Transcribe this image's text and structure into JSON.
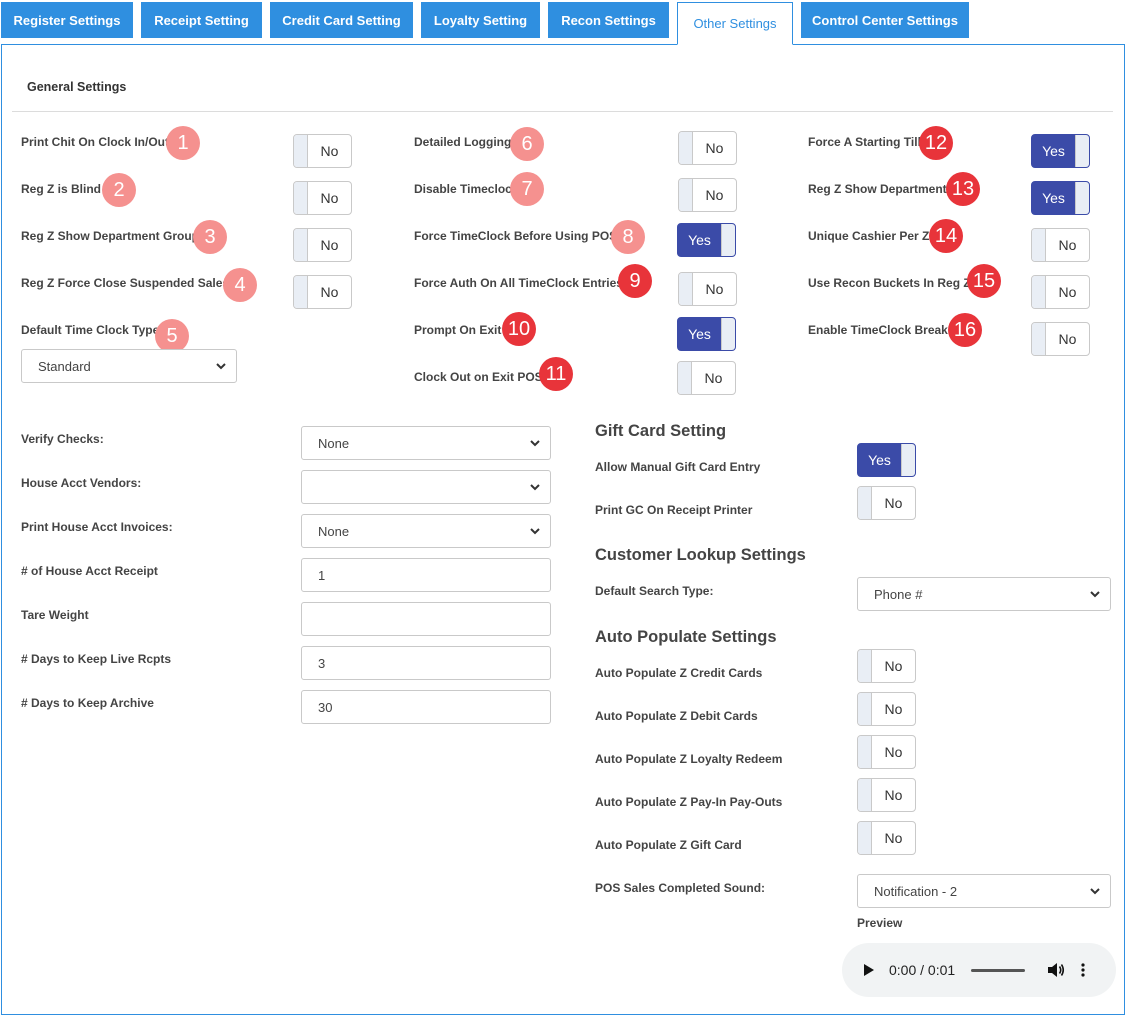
{
  "tabs": [
    "Register Settings",
    "Receipt Setting",
    "Credit Card Setting",
    "Loyalty Setting",
    "Recon Settings",
    "Other Settings",
    "Control Center Settings"
  ],
  "active_tab": "Other Settings",
  "general": {
    "title": "General Settings",
    "col1": [
      {
        "label": "Print Chit On Clock In/Out",
        "value": "No",
        "badge": "1"
      },
      {
        "label": "Reg Z is Blind",
        "value": "No",
        "badge": "2"
      },
      {
        "label": "Reg Z Show Department Group",
        "value": "No",
        "badge": "3"
      },
      {
        "label": "Reg Z Force Close Suspended Sales",
        "value": "No",
        "badge": "4"
      },
      {
        "label": "Default Time Clock Type",
        "badge": "5",
        "select": "Standard"
      }
    ],
    "col2": [
      {
        "label": "Detailed Logging",
        "value": "No",
        "badge": "6"
      },
      {
        "label": "Disable Timeclock",
        "value": "No",
        "badge": "7"
      },
      {
        "label": "Force TimeClock Before Using POS",
        "value": "Yes",
        "badge": "8"
      },
      {
        "label": "Force Auth On All TimeClock Entries",
        "value": "No",
        "badge": "9"
      },
      {
        "label": "Prompt On Exit",
        "value": "Yes",
        "badge": "10"
      },
      {
        "label": "Clock Out on Exit POS",
        "value": "No",
        "badge": "11"
      }
    ],
    "col3": [
      {
        "label": "Force A Starting Till",
        "value": "Yes",
        "badge": "12"
      },
      {
        "label": "Reg Z Show Department",
        "value": "Yes",
        "badge": "13"
      },
      {
        "label": "Unique Cashier Per Z",
        "value": "No",
        "badge": "14"
      },
      {
        "label": "Use Recon Buckets In Reg Z",
        "value": "No",
        "badge": "15"
      },
      {
        "label": "Enable TimeClock Break",
        "value": "No",
        "badge": "16"
      }
    ]
  },
  "left_fields": [
    {
      "label": "Verify Checks:",
      "type": "select",
      "value": "None"
    },
    {
      "label": "House Acct Vendors:",
      "type": "select",
      "value": ""
    },
    {
      "label": "Print House Acct Invoices:",
      "type": "select",
      "value": "None"
    },
    {
      "label": "# of House Acct Receipt",
      "type": "input",
      "value": "1"
    },
    {
      "label": "Tare Weight",
      "type": "input",
      "value": ""
    },
    {
      "label": "# Days to Keep Live Rcpts",
      "type": "input",
      "value": "3"
    },
    {
      "label": "# Days to Keep Archive",
      "type": "input",
      "value": "30"
    }
  ],
  "gift_card": {
    "title": "Gift Card Setting",
    "items": [
      {
        "label": "Allow Manual Gift Card Entry",
        "value": "Yes"
      },
      {
        "label": "Print GC On Receipt Printer",
        "value": "No"
      }
    ]
  },
  "customer_lookup": {
    "title": "Customer Lookup Settings",
    "label": "Default Search Type:",
    "value": "Phone #"
  },
  "auto_populate": {
    "title": "Auto Populate Settings",
    "items": [
      {
        "label": "Auto Populate Z Credit Cards",
        "value": "No"
      },
      {
        "label": "Auto Populate Z Debit Cards",
        "value": "No"
      },
      {
        "label": "Auto Populate Z Loyalty Redeem",
        "value": "No"
      },
      {
        "label": "Auto Populate Z Pay-In Pay-Outs",
        "value": "No"
      },
      {
        "label": "Auto Populate Z Gift Card",
        "value": "No"
      }
    ],
    "sound_label": "POS Sales Completed Sound:",
    "sound_value": "Notification - 2",
    "preview_label": "Preview",
    "audio_time": "0:00 / 0:01"
  },
  "colors": {
    "tab": "#2f8fe0",
    "toggle_on": "#3b4ba8",
    "badge_light": "#f5918f",
    "badge_dark": "#e8343a"
  }
}
